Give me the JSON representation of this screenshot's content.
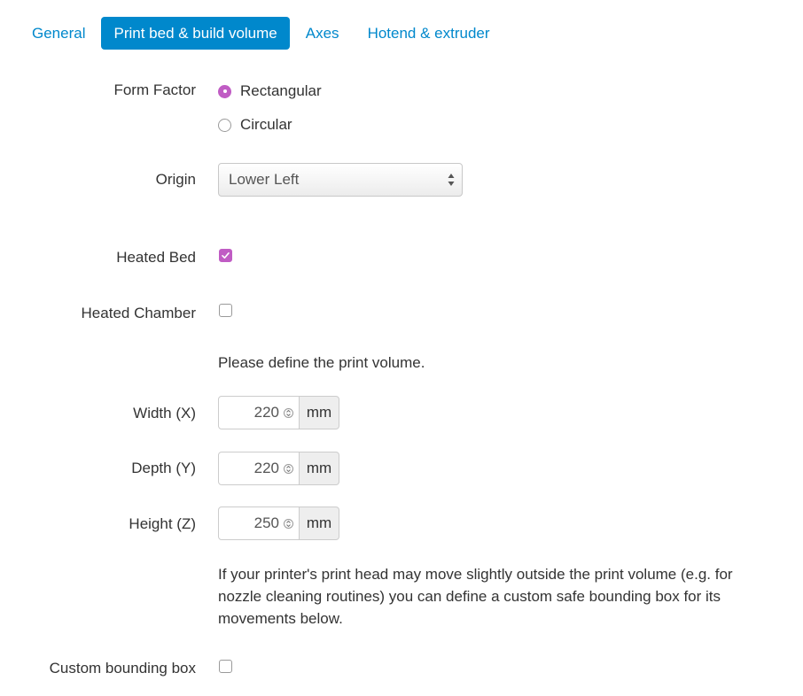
{
  "tabs": [
    {
      "label": "General",
      "active": false
    },
    {
      "label": "Print bed & build volume",
      "active": true
    },
    {
      "label": "Axes",
      "active": false
    },
    {
      "label": "Hotend & extruder",
      "active": false
    }
  ],
  "form_factor": {
    "label": "Form Factor",
    "options": [
      {
        "label": "Rectangular",
        "checked": true
      },
      {
        "label": "Circular",
        "checked": false
      }
    ]
  },
  "origin": {
    "label": "Origin",
    "value": "Lower Left"
  },
  "heated_bed": {
    "label": "Heated Bed",
    "checked": true
  },
  "heated_chamber": {
    "label": "Heated Chamber",
    "checked": false
  },
  "volume_intro": "Please define the print volume.",
  "width": {
    "label": "Width (X)",
    "value": "220",
    "unit": "mm"
  },
  "depth": {
    "label": "Depth (Y)",
    "value": "220",
    "unit": "mm"
  },
  "height": {
    "label": "Height (Z)",
    "value": "250",
    "unit": "mm"
  },
  "bounding_note": "If your printer's print head may move slightly outside the print volume (e.g. for nozzle cleaning routines) you can define a custom safe bounding box for its movements below.",
  "custom_bounding_box": {
    "label": "Custom bounding box",
    "checked": false
  },
  "colors": {
    "accent": "#0088cc",
    "checked": "#c05cc4"
  }
}
